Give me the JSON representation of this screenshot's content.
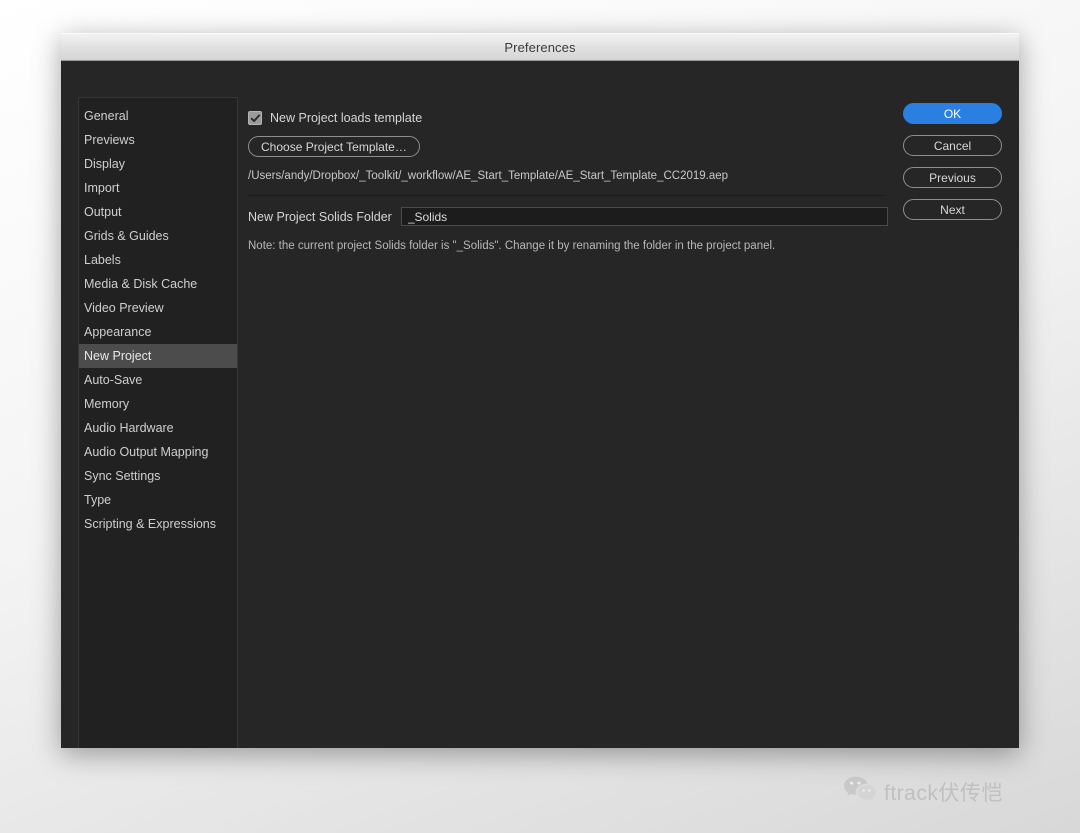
{
  "window": {
    "title": "Preferences"
  },
  "sidebar": {
    "items": [
      {
        "label": "General",
        "selected": false
      },
      {
        "label": "Previews",
        "selected": false
      },
      {
        "label": "Display",
        "selected": false
      },
      {
        "label": "Import",
        "selected": false
      },
      {
        "label": "Output",
        "selected": false
      },
      {
        "label": "Grids & Guides",
        "selected": false
      },
      {
        "label": "Labels",
        "selected": false
      },
      {
        "label": "Media & Disk Cache",
        "selected": false
      },
      {
        "label": "Video Preview",
        "selected": false
      },
      {
        "label": "Appearance",
        "selected": false
      },
      {
        "label": "New Project",
        "selected": true
      },
      {
        "label": "Auto-Save",
        "selected": false
      },
      {
        "label": "Memory",
        "selected": false
      },
      {
        "label": "Audio Hardware",
        "selected": false
      },
      {
        "label": "Audio Output Mapping",
        "selected": false
      },
      {
        "label": "Sync Settings",
        "selected": false
      },
      {
        "label": "Type",
        "selected": false
      },
      {
        "label": "Scripting & Expressions",
        "selected": false
      }
    ]
  },
  "main": {
    "loads_template_checkbox": {
      "label": "New Project loads template",
      "checked": true
    },
    "choose_template_button": "Choose Project Template…",
    "template_path": "/Users/andy/Dropbox/_Toolkit/_workflow/AE_Start_Template/AE_Start_Template_CC2019.aep",
    "solids_folder": {
      "label": "New Project Solids Folder",
      "value": "_Solids",
      "placeholder": "_Solids"
    },
    "note": "Note: the current project Solids folder is \"_Solids\". Change it by renaming the folder in the project panel."
  },
  "buttons": {
    "ok": "OK",
    "cancel": "Cancel",
    "previous": "Previous",
    "next": "Next"
  },
  "watermark": {
    "text": "ftrack伏传恺",
    "icon": "wechat-icon"
  },
  "colors": {
    "accent": "#2b7fe0",
    "dialog_bg": "#262626",
    "sidebar_bg": "#212121",
    "selection": "#4c4c4c",
    "titlebar": "#e2e2e2"
  }
}
